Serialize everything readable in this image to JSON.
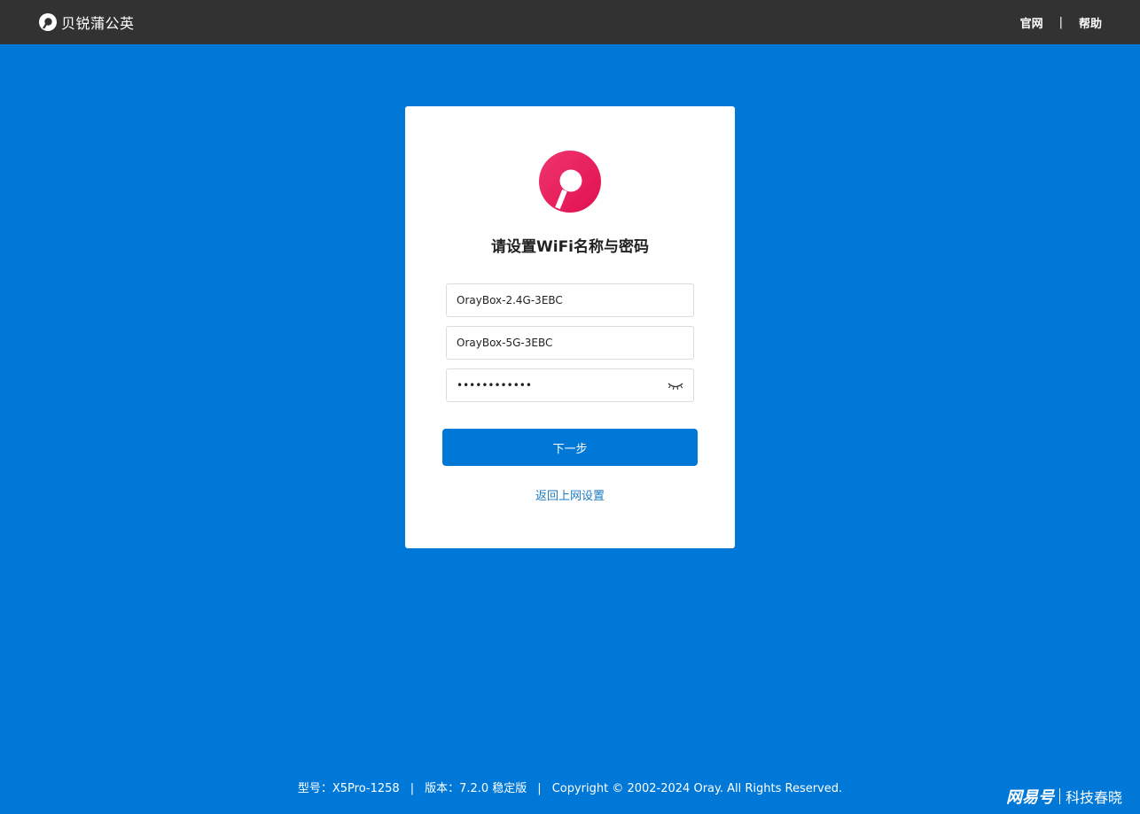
{
  "header": {
    "brand_name": "贝锐蒲公英",
    "links": [
      {
        "label": "官网"
      },
      {
        "label": "帮助"
      }
    ],
    "separator": "|"
  },
  "card": {
    "title": "请设置WiFi名称与密码",
    "ssid_24g": {
      "value": "OrayBox-2.4G-3EBC"
    },
    "ssid_5g": {
      "value": "OrayBox-5G-3EBC"
    },
    "password": {
      "value": "••••••••••••"
    },
    "next_label": "下一步",
    "back_label": "返回上网设置"
  },
  "footer": {
    "model": "型号：X5Pro-1258",
    "version": "版本：7.2.0 稳定版",
    "copyright": "Copyright © 2002-2024 Oray. All Rights Reserved.",
    "separator": "|"
  },
  "watermark": {
    "brand": "网易号",
    "author": "科技春晓"
  },
  "colors": {
    "page_bg": "#0078d7",
    "topbar_bg": "#323232",
    "logo_red": "#e8195c",
    "button_bg": "#0078d7",
    "link": "#1a7ac2"
  }
}
